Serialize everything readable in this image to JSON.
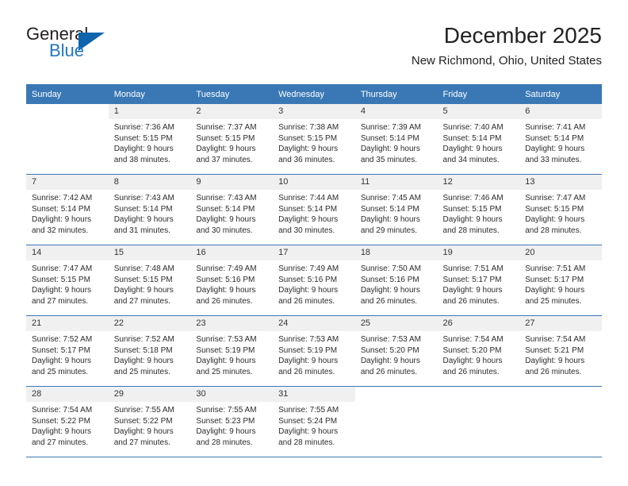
{
  "brand": {
    "word1": "General",
    "word2": "Blue",
    "triangle_color": "#1064ab",
    "blue_color": "#2077c0"
  },
  "header": {
    "title": "December 2025",
    "subtitle": "New Richmond, Ohio, United States",
    "header_bg": "#3a78b5"
  },
  "weekdays": [
    "Sunday",
    "Monday",
    "Tuesday",
    "Wednesday",
    "Thursday",
    "Friday",
    "Saturday"
  ],
  "weeks": [
    [
      {
        "day": "",
        "sunrise": "",
        "sunset": "",
        "daylight": "",
        "daylight2": ""
      },
      {
        "day": "1",
        "sunrise": "Sunrise: 7:36 AM",
        "sunset": "Sunset: 5:15 PM",
        "daylight": "Daylight: 9 hours",
        "daylight2": "and 38 minutes."
      },
      {
        "day": "2",
        "sunrise": "Sunrise: 7:37 AM",
        "sunset": "Sunset: 5:15 PM",
        "daylight": "Daylight: 9 hours",
        "daylight2": "and 37 minutes."
      },
      {
        "day": "3",
        "sunrise": "Sunrise: 7:38 AM",
        "sunset": "Sunset: 5:15 PM",
        "daylight": "Daylight: 9 hours",
        "daylight2": "and 36 minutes."
      },
      {
        "day": "4",
        "sunrise": "Sunrise: 7:39 AM",
        "sunset": "Sunset: 5:14 PM",
        "daylight": "Daylight: 9 hours",
        "daylight2": "and 35 minutes."
      },
      {
        "day": "5",
        "sunrise": "Sunrise: 7:40 AM",
        "sunset": "Sunset: 5:14 PM",
        "daylight": "Daylight: 9 hours",
        "daylight2": "and 34 minutes."
      },
      {
        "day": "6",
        "sunrise": "Sunrise: 7:41 AM",
        "sunset": "Sunset: 5:14 PM",
        "daylight": "Daylight: 9 hours",
        "daylight2": "and 33 minutes."
      }
    ],
    [
      {
        "day": "7",
        "sunrise": "Sunrise: 7:42 AM",
        "sunset": "Sunset: 5:14 PM",
        "daylight": "Daylight: 9 hours",
        "daylight2": "and 32 minutes."
      },
      {
        "day": "8",
        "sunrise": "Sunrise: 7:43 AM",
        "sunset": "Sunset: 5:14 PM",
        "daylight": "Daylight: 9 hours",
        "daylight2": "and 31 minutes."
      },
      {
        "day": "9",
        "sunrise": "Sunrise: 7:43 AM",
        "sunset": "Sunset: 5:14 PM",
        "daylight": "Daylight: 9 hours",
        "daylight2": "and 30 minutes."
      },
      {
        "day": "10",
        "sunrise": "Sunrise: 7:44 AM",
        "sunset": "Sunset: 5:14 PM",
        "daylight": "Daylight: 9 hours",
        "daylight2": "and 30 minutes."
      },
      {
        "day": "11",
        "sunrise": "Sunrise: 7:45 AM",
        "sunset": "Sunset: 5:14 PM",
        "daylight": "Daylight: 9 hours",
        "daylight2": "and 29 minutes."
      },
      {
        "day": "12",
        "sunrise": "Sunrise: 7:46 AM",
        "sunset": "Sunset: 5:15 PM",
        "daylight": "Daylight: 9 hours",
        "daylight2": "and 28 minutes."
      },
      {
        "day": "13",
        "sunrise": "Sunrise: 7:47 AM",
        "sunset": "Sunset: 5:15 PM",
        "daylight": "Daylight: 9 hours",
        "daylight2": "and 28 minutes."
      }
    ],
    [
      {
        "day": "14",
        "sunrise": "Sunrise: 7:47 AM",
        "sunset": "Sunset: 5:15 PM",
        "daylight": "Daylight: 9 hours",
        "daylight2": "and 27 minutes."
      },
      {
        "day": "15",
        "sunrise": "Sunrise: 7:48 AM",
        "sunset": "Sunset: 5:15 PM",
        "daylight": "Daylight: 9 hours",
        "daylight2": "and 27 minutes."
      },
      {
        "day": "16",
        "sunrise": "Sunrise: 7:49 AM",
        "sunset": "Sunset: 5:16 PM",
        "daylight": "Daylight: 9 hours",
        "daylight2": "and 26 minutes."
      },
      {
        "day": "17",
        "sunrise": "Sunrise: 7:49 AM",
        "sunset": "Sunset: 5:16 PM",
        "daylight": "Daylight: 9 hours",
        "daylight2": "and 26 minutes."
      },
      {
        "day": "18",
        "sunrise": "Sunrise: 7:50 AM",
        "sunset": "Sunset: 5:16 PM",
        "daylight": "Daylight: 9 hours",
        "daylight2": "and 26 minutes."
      },
      {
        "day": "19",
        "sunrise": "Sunrise: 7:51 AM",
        "sunset": "Sunset: 5:17 PM",
        "daylight": "Daylight: 9 hours",
        "daylight2": "and 26 minutes."
      },
      {
        "day": "20",
        "sunrise": "Sunrise: 7:51 AM",
        "sunset": "Sunset: 5:17 PM",
        "daylight": "Daylight: 9 hours",
        "daylight2": "and 25 minutes."
      }
    ],
    [
      {
        "day": "21",
        "sunrise": "Sunrise: 7:52 AM",
        "sunset": "Sunset: 5:17 PM",
        "daylight": "Daylight: 9 hours",
        "daylight2": "and 25 minutes."
      },
      {
        "day": "22",
        "sunrise": "Sunrise: 7:52 AM",
        "sunset": "Sunset: 5:18 PM",
        "daylight": "Daylight: 9 hours",
        "daylight2": "and 25 minutes."
      },
      {
        "day": "23",
        "sunrise": "Sunrise: 7:53 AM",
        "sunset": "Sunset: 5:19 PM",
        "daylight": "Daylight: 9 hours",
        "daylight2": "and 25 minutes."
      },
      {
        "day": "24",
        "sunrise": "Sunrise: 7:53 AM",
        "sunset": "Sunset: 5:19 PM",
        "daylight": "Daylight: 9 hours",
        "daylight2": "and 26 minutes."
      },
      {
        "day": "25",
        "sunrise": "Sunrise: 7:53 AM",
        "sunset": "Sunset: 5:20 PM",
        "daylight": "Daylight: 9 hours",
        "daylight2": "and 26 minutes."
      },
      {
        "day": "26",
        "sunrise": "Sunrise: 7:54 AM",
        "sunset": "Sunset: 5:20 PM",
        "daylight": "Daylight: 9 hours",
        "daylight2": "and 26 minutes."
      },
      {
        "day": "27",
        "sunrise": "Sunrise: 7:54 AM",
        "sunset": "Sunset: 5:21 PM",
        "daylight": "Daylight: 9 hours",
        "daylight2": "and 26 minutes."
      }
    ],
    [
      {
        "day": "28",
        "sunrise": "Sunrise: 7:54 AM",
        "sunset": "Sunset: 5:22 PM",
        "daylight": "Daylight: 9 hours",
        "daylight2": "and 27 minutes."
      },
      {
        "day": "29",
        "sunrise": "Sunrise: 7:55 AM",
        "sunset": "Sunset: 5:22 PM",
        "daylight": "Daylight: 9 hours",
        "daylight2": "and 27 minutes."
      },
      {
        "day": "30",
        "sunrise": "Sunrise: 7:55 AM",
        "sunset": "Sunset: 5:23 PM",
        "daylight": "Daylight: 9 hours",
        "daylight2": "and 28 minutes."
      },
      {
        "day": "31",
        "sunrise": "Sunrise: 7:55 AM",
        "sunset": "Sunset: 5:24 PM",
        "daylight": "Daylight: 9 hours",
        "daylight2": "and 28 minutes."
      },
      {
        "day": "",
        "sunrise": "",
        "sunset": "",
        "daylight": "",
        "daylight2": ""
      },
      {
        "day": "",
        "sunrise": "",
        "sunset": "",
        "daylight": "",
        "daylight2": ""
      },
      {
        "day": "",
        "sunrise": "",
        "sunset": "",
        "daylight": "",
        "daylight2": ""
      }
    ]
  ]
}
